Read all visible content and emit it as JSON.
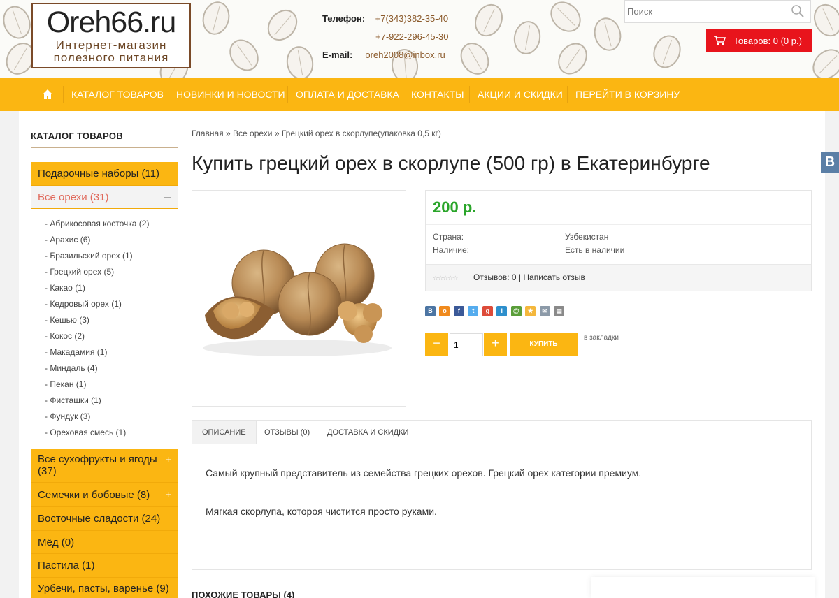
{
  "header": {
    "logo_title": "Oreh66.ru",
    "logo_subtitle_line1": "Интернет-магазин",
    "logo_subtitle_line2": "полезного питания",
    "phone_label": "Телефон:",
    "phone1": "+7(343)382-35-40",
    "phone2": "+7-922-296-45-30",
    "email_label": "E-mail:",
    "email": "oreh2008@inbox.ru",
    "search_placeholder": "Поиск",
    "cart_label": "Товаров: 0 (0 р.)"
  },
  "nav": {
    "items": [
      "КАТАЛОГ ТОВАРОВ",
      "НОВИНКИ И НОВОСТИ",
      "ОПЛАТА И ДОСТАВКА",
      "КОНТАКТЫ",
      "АКЦИИ И СКИДКИ",
      "ПЕРЕЙТИ В КОРЗИНУ"
    ]
  },
  "sidebar": {
    "title": "КАТАЛОГ ТОВАРОВ",
    "categories": [
      "Подарочные наборы (11)",
      "Все орехи (31)",
      "Все сухофрукты и ягоды (37)",
      "Семечки и бобовые (8)",
      "Восточные сладости (24)",
      "Мёд (0)",
      "Пастила (1)",
      "Урбечи, пасты, варенье (9)"
    ],
    "subitems": [
      "- Абрикосовая косточка (2)",
      "- Арахис (6)",
      "- Бразильский орех (1)",
      "- Грецкий орех (5)",
      "- Какао (1)",
      "- Кедровый орех (1)",
      "- Кешью (3)",
      "- Кокос (2)",
      "- Макадамия (1)",
      "- Миндаль (4)",
      "- Пекан (1)",
      "- Фисташки (1)",
      "- Фундук (3)",
      "- Ореховая смесь (1)"
    ]
  },
  "breadcrumb": "Главная » Все орехи » Грецкий орех в скорлупе(упаковка 0,5 кг)",
  "product": {
    "title": "Купить грецкий орех в скорлупе (500 гр) в Екатеринбурге",
    "price": "200 р.",
    "country_label": "Страна:",
    "country_value": "Узбекистан",
    "stock_label": "Наличие:",
    "stock_value": "Есть в наличии",
    "reviews_text": "Отзывов: 0  |  Написать отзыв",
    "quantity": "1",
    "buy_label": "КУПИТЬ",
    "bookmark_label": "в закладки",
    "minus_label": "−",
    "plus_label": "+"
  },
  "tabs": {
    "items": [
      "ОПИСАНИЕ",
      "ОТЗЫВЫ (0)",
      "ДОСТАВКА И СКИДКИ"
    ],
    "description_p1": "Самый крупный представитель из семейства грецких орехов. Грецкий орех категории премиум.",
    "description_p2": "Мягкая скорлупа, котороя чистится просто руками."
  },
  "similar_title": "ПОХОЖИЕ ТОВАРЫ (4)",
  "vk_label": "B",
  "colors": {
    "accent": "#fbb612",
    "cart": "#e8141c",
    "price": "#2aa52a",
    "active_category": "#e06a5c"
  }
}
